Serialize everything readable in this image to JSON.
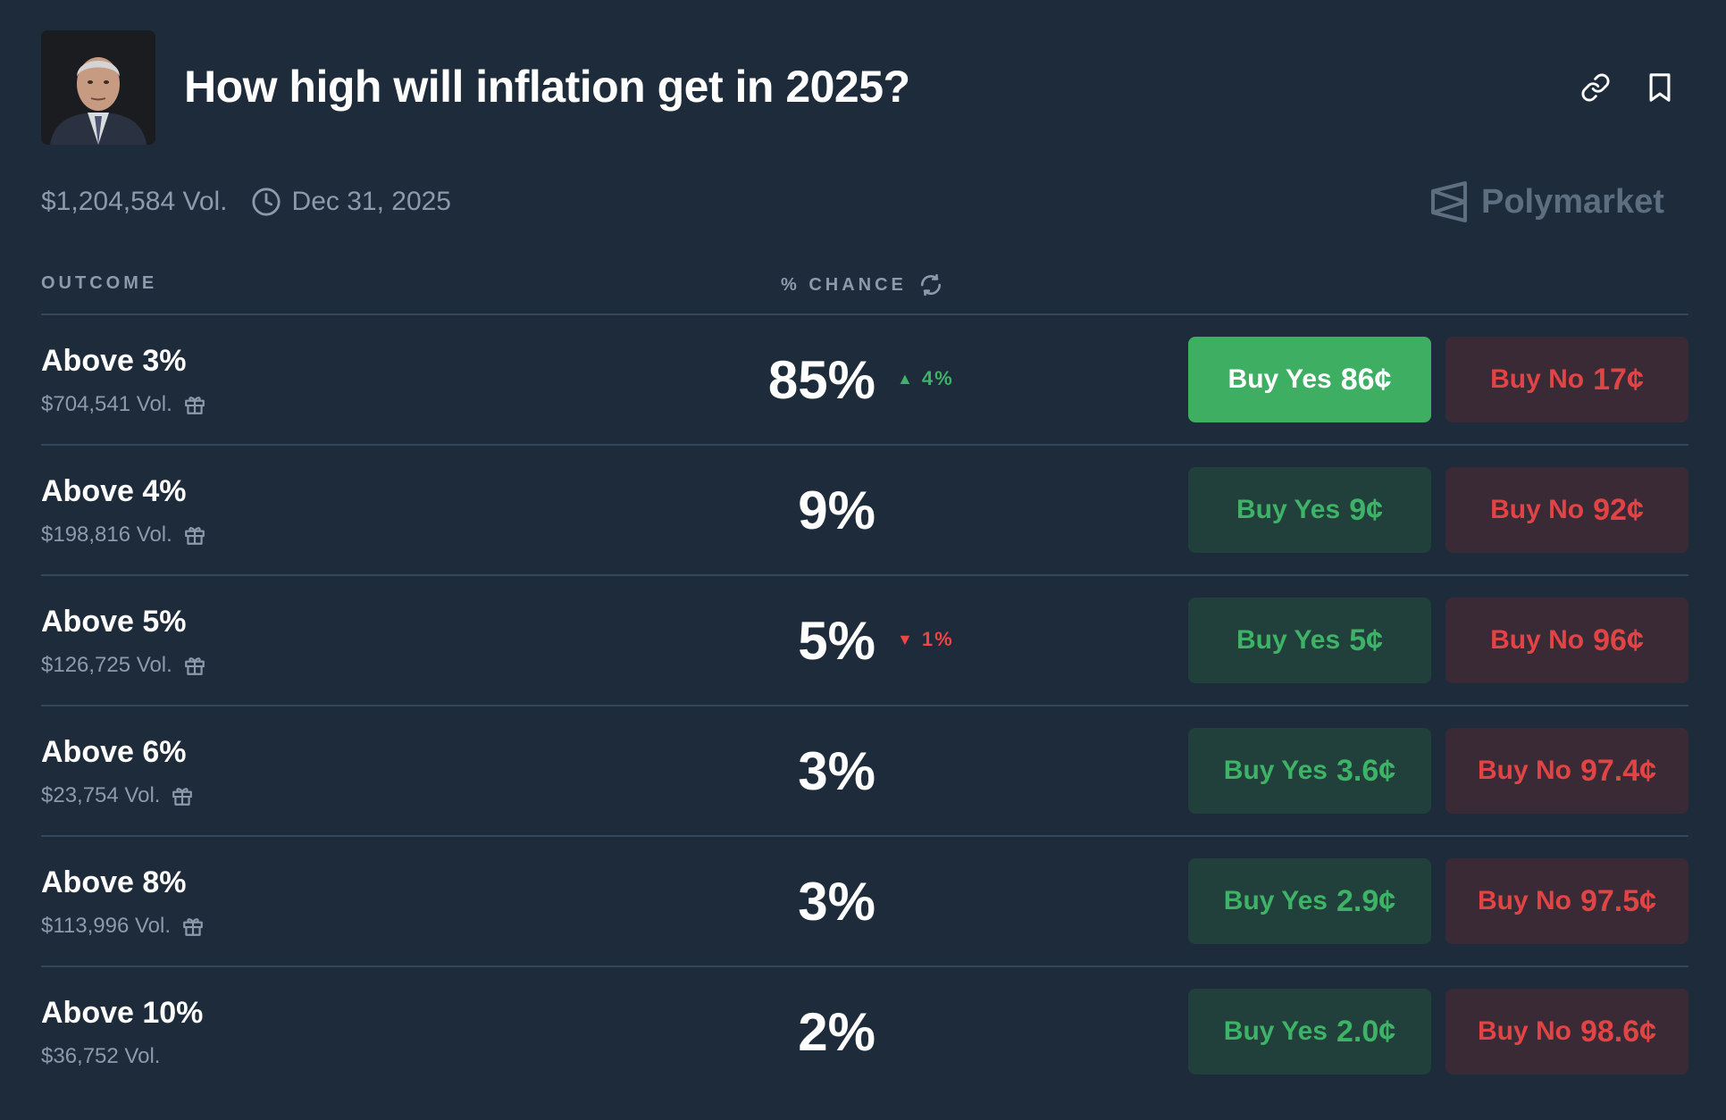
{
  "market": {
    "title": "How high will inflation get in 2025?",
    "volume": "$1,204,584 Vol.",
    "end_date": "Dec 31, 2025",
    "brand": "Polymarket"
  },
  "table": {
    "col_outcome": "OUTCOME",
    "col_chance": "% CHANCE"
  },
  "colors": {
    "background": "#1d2b3a",
    "yes_green": "#3eb266",
    "no_red": "#e04444",
    "divider": "#34465a"
  },
  "outcomes": [
    {
      "name": "Above 3%",
      "volume": "$704,541 Vol.",
      "chance": "85%",
      "change": "4%",
      "change_dir": "up",
      "yes_label": "Buy Yes",
      "yes_price": "86¢",
      "no_label": "Buy No",
      "no_price": "17¢",
      "yes_active": true
    },
    {
      "name": "Above 4%",
      "volume": "$198,816 Vol.",
      "chance": "9%",
      "change": "",
      "change_dir": "",
      "yes_label": "Buy Yes",
      "yes_price": "9¢",
      "no_label": "Buy No",
      "no_price": "92¢"
    },
    {
      "name": "Above 5%",
      "volume": "$126,725 Vol.",
      "chance": "5%",
      "change": "1%",
      "change_dir": "down",
      "yes_label": "Buy Yes",
      "yes_price": "5¢",
      "no_label": "Buy No",
      "no_price": "96¢"
    },
    {
      "name": "Above 6%",
      "volume": "$23,754 Vol.",
      "chance": "3%",
      "change": "",
      "change_dir": "",
      "yes_label": "Buy Yes",
      "yes_price": "3.6¢",
      "no_label": "Buy No",
      "no_price": "97.4¢"
    },
    {
      "name": "Above 8%",
      "volume": "$113,996 Vol.",
      "chance": "3%",
      "change": "",
      "change_dir": "",
      "yes_label": "Buy Yes",
      "yes_price": "2.9¢",
      "no_label": "Buy No",
      "no_price": "97.5¢"
    },
    {
      "name": "Above 10%",
      "volume": "$36,752 Vol.",
      "chance": "2%",
      "change": "",
      "change_dir": "",
      "yes_label": "Buy Yes",
      "yes_price": "2.0¢",
      "no_label": "Buy No",
      "no_price": "98.6¢"
    }
  ]
}
